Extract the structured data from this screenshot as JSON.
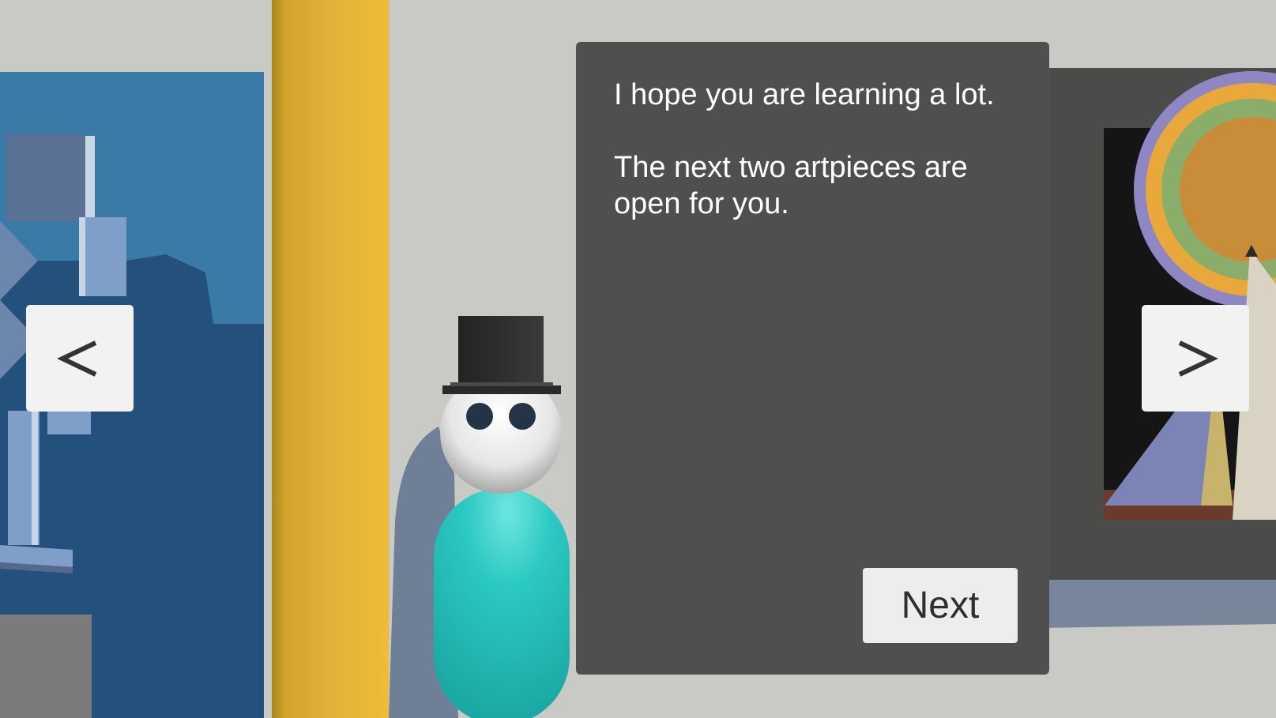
{
  "dialog": {
    "line1": "I hope you are learning a lot.",
    "line2": "The next two artpieces are open for you.",
    "next_label": "Next"
  },
  "navigation": {
    "prev_label": "<",
    "next_label": ">"
  },
  "colors": {
    "dialog_bg": "#4f4f4f",
    "button_bg": "#ededed",
    "wall": "#c9cac5",
    "pillar": "#e7b73a",
    "character_body": "#27c6c2",
    "left_artwork_bg": "#24507c"
  }
}
